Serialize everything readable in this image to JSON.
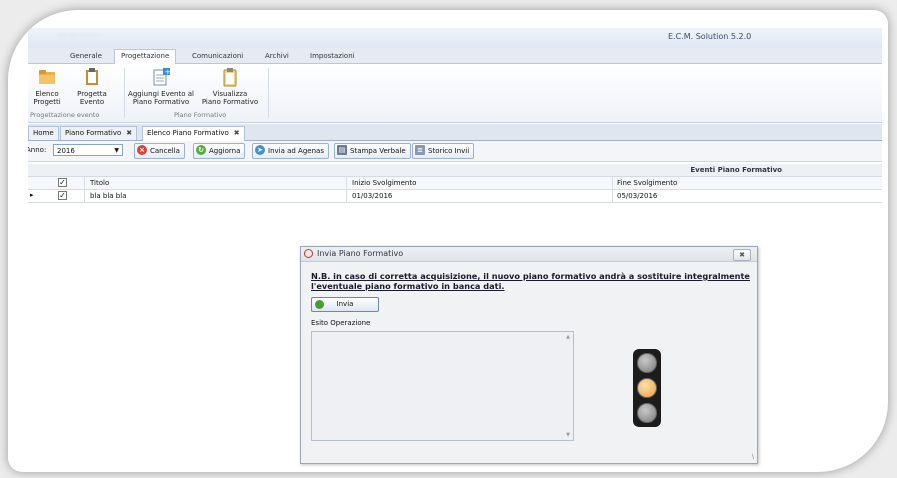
{
  "window": {
    "title": "E.C.M. Solution 5.2.0",
    "blurred_text": "···· ····  ········ ·"
  },
  "ribbon_tabs": [
    "Generale",
    "Progettazione",
    "Comunicazioni",
    "Archivi",
    "Impostazioni"
  ],
  "ribbon": {
    "elenco_progetti": [
      "Elenco",
      "Progetti"
    ],
    "progetta_evento": [
      "Progetta",
      "Evento"
    ],
    "aggiungi_evento": [
      "Aggiungi Evento al",
      "Piano Formativo"
    ],
    "visualizza_piano": [
      "Visualizza",
      "Piano Formativo"
    ],
    "group1": "Progettazione evento",
    "group2": "Piano Formativo"
  },
  "doc_tabs": {
    "home": "Home",
    "piano": "Piano Formativo",
    "elenco": "Elenco Piano Formativo",
    "close": "✖"
  },
  "toolbar": {
    "anno_label": "Anno:",
    "anno_value": "2016",
    "cancella": "Cancella",
    "aggiorna": "Aggiorna",
    "invia_agenas": "Invia ad Agenas",
    "stampa_verbale": "Stampa Verbale",
    "storico_invii": "Storico Invii"
  },
  "grid": {
    "section_title": "Eventi Piano Formativo",
    "columns": [
      "Titolo",
      "Inizio Svolgimento",
      "Fine Svolgimento"
    ],
    "rows": [
      {
        "titolo": "bla bla bla",
        "inizio": "01/03/2016",
        "fine": "05/03/2016",
        "checked": true
      }
    ],
    "header_checked": true
  },
  "dialog": {
    "title": "Invia Piano Formativo",
    "note_line1": "N.B. in caso di corretta acquisizione, il nuovo piano formativo andrà a sostituire integralmente",
    "note_line2": "l'eventuale piano formativo in banca dati.",
    "invia_button": "Invia",
    "esito_label": "Esito Operazione",
    "esito_value": "",
    "close": "✖",
    "traffic_light": {
      "red": "off",
      "yellow": "on",
      "green": "off"
    }
  },
  "colors": {
    "accent": "#9eb0ce",
    "yellow_on": "#f0b45a",
    "light_off": "#8a8a8a"
  }
}
